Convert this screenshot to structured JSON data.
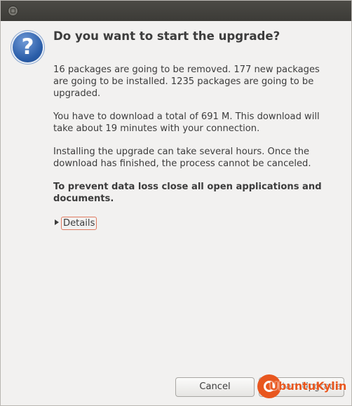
{
  "dialog": {
    "heading": "Do you want to start the upgrade?",
    "packages_text": "16 packages are going to be removed. 177 new packages are going to be installed. 1235 packages are going to be upgraded.",
    "download_text": "You have to download a total of 691 M. This download will take about 19 minutes with your connection.",
    "install_text": "Installing the upgrade can take several hours. Once the download has finished, the process cannot be canceled.",
    "warning_text": "To prevent data loss close all open applications and documents.",
    "details_label": "Details"
  },
  "buttons": {
    "cancel": "Cancel",
    "start": "Start Upgrade"
  },
  "icons": {
    "question": "?",
    "watermark": "UbuntuKylin"
  },
  "colors": {
    "accent": "#e8571f",
    "question_icon": "#2a5da8"
  }
}
